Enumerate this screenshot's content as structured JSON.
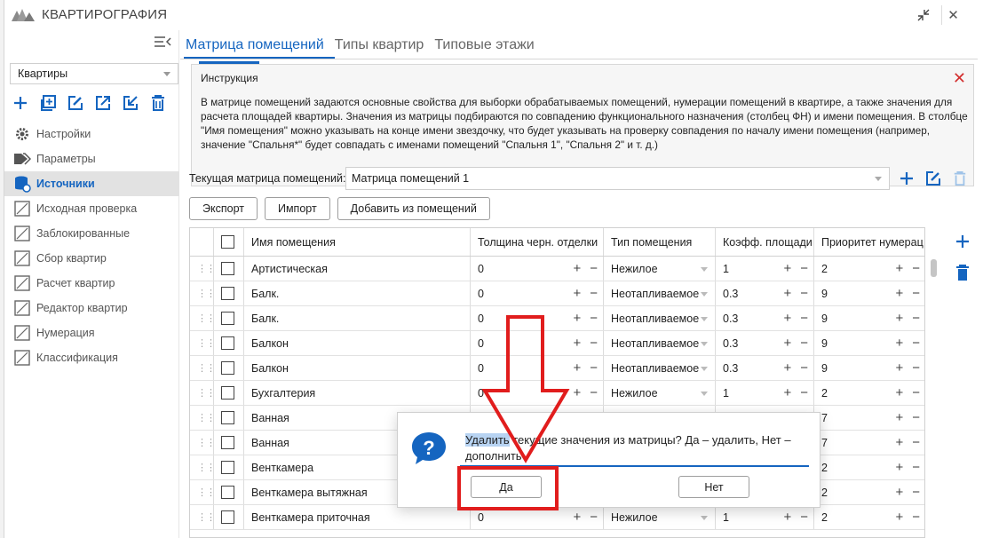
{
  "app": {
    "title": "КВАРТИРОГРАФИЯ"
  },
  "sidebar": {
    "combo_value": "Квартиры",
    "nav": [
      {
        "label": "Настройки",
        "icon": "gear-icon"
      },
      {
        "label": "Параметры",
        "icon": "tags-icon"
      },
      {
        "label": "Источники",
        "icon": "database-icon"
      },
      {
        "label": "Исходная проверка",
        "icon": "check-doc-icon"
      },
      {
        "label": "Заблокированные",
        "icon": "lock-doc-icon"
      },
      {
        "label": "Сбор квартир",
        "icon": "collect-doc-icon"
      },
      {
        "label": "Расчет квартир",
        "icon": "calc-doc-icon"
      },
      {
        "label": "Редактор квартир",
        "icon": "edit-doc-icon"
      },
      {
        "label": "Нумерация",
        "icon": "hash-doc-icon"
      },
      {
        "label": "Классификация",
        "icon": "class-doc-icon"
      }
    ],
    "active_index": 2
  },
  "tabs": [
    "Матрица помещений",
    "Типы квартир",
    "Типовые этажи"
  ],
  "instruction": {
    "title": "Инструкция",
    "body": "В матрице помещений задаются основные свойства для выборки обрабатываемых помещений, нумерации помещений в квартире, а также значения для расчета площадей квартиры. Значения из матрицы подбираются по совпадению функционального назначения (столбец ФН) и имени помещения. В столбце \"Имя помещения\" можно указывать на конце имени звездочку, что будет указывать на проверку совпадения по началу имени помещения (например, значение \"Спальня*\" будет совпадать с именами помещений \"Спальня 1\", \"Спальня 2\" и т. д.)"
  },
  "current_matrix": {
    "label": "Текущая матрица помещений:",
    "value": "Матрица помещений 1"
  },
  "buttons": {
    "export": "Экспорт",
    "import": "Импорт",
    "add_from_rooms": "Добавить из помещений"
  },
  "table": {
    "headers": [
      "Имя помещения",
      "Толщина черн. отделки",
      "Тип помещения",
      "Коэфф. площади",
      "Приоритет нумерац"
    ],
    "rows": [
      [
        "Артистическая",
        "0",
        "Нежилое",
        "1",
        "2"
      ],
      [
        "Балк.",
        "0",
        "Неотапливаемое",
        "0.3",
        "9"
      ],
      [
        "Балк.",
        "0",
        "Неотапливаемое",
        "0.3",
        "9"
      ],
      [
        "Балкон",
        "0",
        "Неотапливаемое",
        "0.3",
        "9"
      ],
      [
        "Балкон",
        "0",
        "Неотапливаемое",
        "0.3",
        "9"
      ],
      [
        "Бухгалтерия",
        "0",
        "Нежилое",
        "1",
        "2"
      ],
      [
        "Ванная",
        "",
        "",
        "",
        "7"
      ],
      [
        "Ванная",
        "",
        "",
        "",
        "7"
      ],
      [
        "Венткамера",
        "",
        "",
        "",
        "2"
      ],
      [
        "Венткамера вытяжная",
        "",
        "",
        "",
        "2"
      ],
      [
        "Венткамера приточная",
        "0",
        "Нежилое",
        "1",
        "2"
      ]
    ]
  },
  "dialog": {
    "text_highlight": "Удалить",
    "text_rest": " текущие значения из матрицы? Да – удалить, Нет – дополнить",
    "yes": "Да",
    "no": "Нет"
  },
  "colors": {
    "accent": "#1565c0",
    "annotation": "#e11d1d",
    "close": "#d32f2f"
  }
}
